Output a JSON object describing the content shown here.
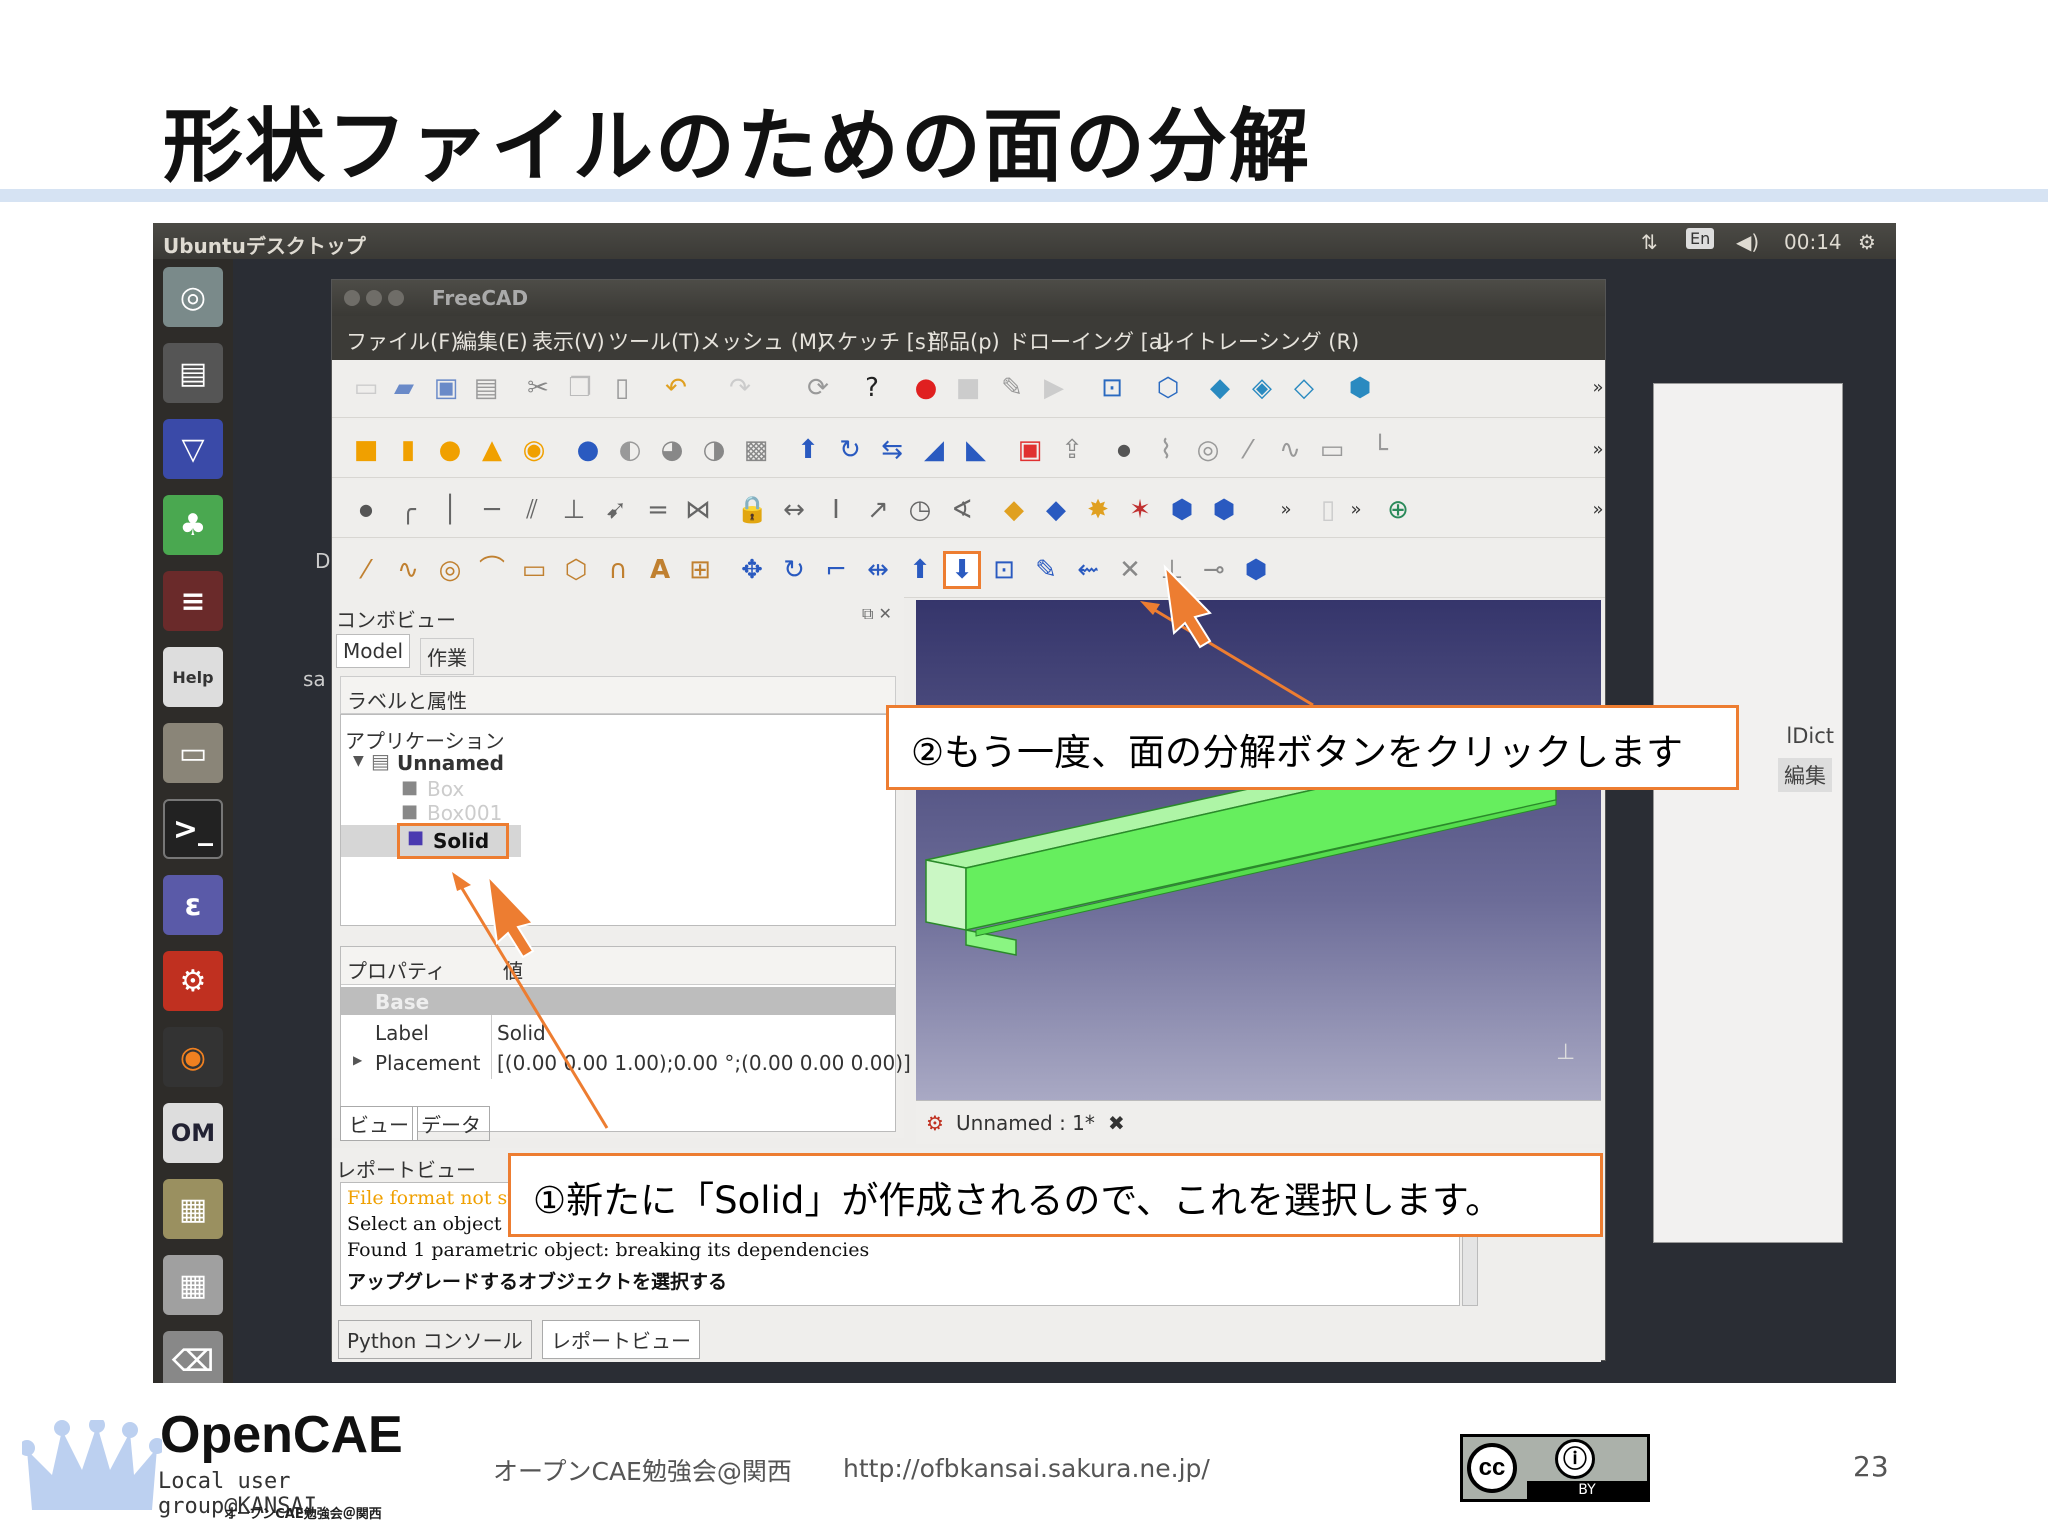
{
  "slide": {
    "title": "形状ファイルのための面の分解",
    "page_number": "23"
  },
  "desktop": {
    "title": "Ubuntuデスクトップ",
    "keyboard": "En",
    "clock": "00:14",
    "partial_labels": {
      "d": "D",
      "sa": "sa",
      "dict": "lDict",
      "edit": "編集"
    }
  },
  "freecad": {
    "window_title": "FreeCAD",
    "menu": [
      "ファイル(F)",
      "編集(E)",
      "表示(V)",
      "ツール(T)",
      "メッシュ (M)",
      "スケッチ [s]",
      "部品(p)",
      "ドローイング [a]",
      "レイトレーシング (R)"
    ],
    "overflow": "»",
    "combo_view": {
      "title": "コンボビュー",
      "tabs": [
        "Model",
        "作業"
      ],
      "tree_header": "ラベルと属性",
      "tree": {
        "root": "アプリケーション",
        "document": "Unnamed",
        "children": [
          "Box",
          "Box001",
          "Solid"
        ]
      },
      "properties": {
        "header_property": "プロパティ",
        "header_value": "値",
        "group": "Base",
        "rows": [
          {
            "name": "Label",
            "value": "Solid"
          },
          {
            "name": "Placement",
            "value": "[(0.00 0.00 1.00);0.00 °;(0.00 0.00 0.00)]"
          }
        ]
      },
      "bottom_tabs": [
        "ビュー",
        "データ"
      ]
    },
    "view_tab": "Unnamed : 1*",
    "report": {
      "title": "レポートビュー",
      "lines": [
        {
          "text": "File format not su",
          "color": "#f0a000"
        },
        {
          "text": "Select an object to project",
          "color": "#111111"
        },
        {
          "text": "Found 1 parametric object: breaking its dependencies",
          "color": "#111111"
        },
        {
          "text": "アップグレードするオブジェクトを選択する",
          "color": "#111111"
        }
      ],
      "tabs": [
        "Python コンソール",
        "レポートビュー"
      ]
    }
  },
  "callouts": {
    "step1": "①新たに「Solid」が作成されるので、これを選択します。",
    "step2": "②もう一度、面の分解ボタンをクリックします",
    "accent": "#ed7d31"
  },
  "footer": {
    "logo": "OpenCAE",
    "logo_sub": "Local user group@KANSAI",
    "logo_sub2": "オープンCAE勉強会＠関西",
    "study_group": "オープンCAE勉強会@関西",
    "url": "http://ofbkansai.sakura.ne.jp/",
    "license_by": "BY"
  }
}
